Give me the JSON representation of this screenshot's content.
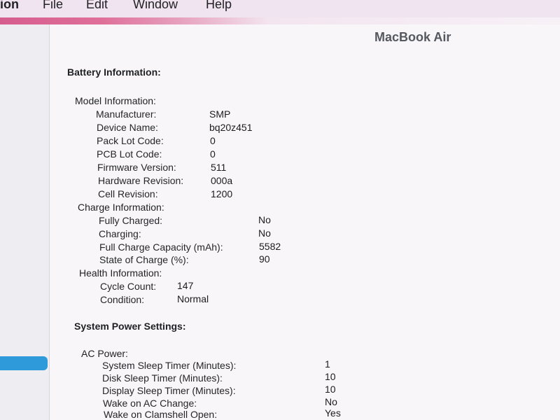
{
  "menu": {
    "app_fragment": "ion",
    "items": [
      "File",
      "Edit",
      "Window",
      "Help"
    ]
  },
  "device": {
    "title": "MacBook Air"
  },
  "battery": {
    "title": "Battery Information:",
    "model": {
      "label": "Model Information:",
      "rows": [
        {
          "label": "Manufacturer:",
          "value": "SMP"
        },
        {
          "label": "Device Name:",
          "value": "bq20z451"
        },
        {
          "label": "Pack Lot Code:",
          "value": "0"
        },
        {
          "label": "PCB Lot Code:",
          "value": "0"
        },
        {
          "label": "Firmware Version:",
          "value": "511"
        },
        {
          "label": "Hardware Revision:",
          "value": "000a"
        },
        {
          "label": "Cell Revision:",
          "value": "1200"
        }
      ]
    },
    "charge": {
      "label": "Charge Information:",
      "rows": [
        {
          "label": "Fully Charged:",
          "value": "No"
        },
        {
          "label": "Charging:",
          "value": "No"
        },
        {
          "label": "Full Charge Capacity (mAh):",
          "value": "5582"
        },
        {
          "label": "State of Charge (%):",
          "value": "90"
        }
      ]
    },
    "health": {
      "label": "Health Information:",
      "rows": [
        {
          "label": "Cycle Count:",
          "value": "147"
        },
        {
          "label": "Condition:",
          "value": "Normal"
        }
      ]
    }
  },
  "power": {
    "title": "System Power Settings:",
    "ac": {
      "label": "AC Power:",
      "rows": [
        {
          "label": "System Sleep Timer (Minutes):",
          "value": "1"
        },
        {
          "label": "Disk Sleep Timer (Minutes):",
          "value": "10"
        },
        {
          "label": "Display Sleep Timer (Minutes):",
          "value": "10"
        },
        {
          "label": "Wake on AC Change:",
          "value": "No"
        },
        {
          "label": "Wake on Clamshell Open:",
          "value": "Yes"
        }
      ]
    }
  }
}
